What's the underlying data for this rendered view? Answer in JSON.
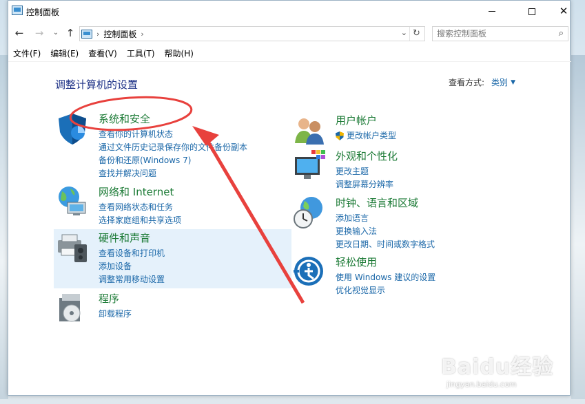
{
  "window": {
    "title": "控制面板",
    "close_glyph": "✕"
  },
  "nav": {
    "back_glyph": "←",
    "forward_glyph": "→",
    "recent_glyph": "⌄",
    "up_glyph": "↑",
    "address_sep": "›",
    "address_path": "控制面板",
    "address_sep_end": "›",
    "dropdown_glyph": "⌄",
    "refresh_glyph": "↻",
    "search_placeholder": "搜索控制面板",
    "search_glyph": "⌕"
  },
  "menu": {
    "items": [
      "文件(F)",
      "编辑(E)",
      "查看(V)",
      "工具(T)",
      "帮助(H)"
    ]
  },
  "main": {
    "heading": "调整计算机的设置",
    "view_by_label": "查看方式:",
    "view_by_value": "类别",
    "view_by_caret": "▼"
  },
  "categories": [
    {
      "title": "系统和安全",
      "icon": "shield-icon",
      "links": [
        "查看你的计算机状态",
        "通过文件历史记录保存你的文件备份副本",
        "备份和还原(Windows 7)",
        "查找并解决问题"
      ]
    },
    {
      "title": "网络和 Internet",
      "icon": "network-globe-icon",
      "links": [
        "查看网络状态和任务",
        "选择家庭组和共享选项"
      ]
    },
    {
      "title": "硬件和声音",
      "icon": "printer-speaker-icon",
      "links": [
        "查看设备和打印机",
        "添加设备",
        "调整常用移动设置"
      ]
    },
    {
      "title": "程序",
      "icon": "programs-disc-icon",
      "links": [
        "卸载程序"
      ]
    },
    {
      "title": "用户帐户",
      "icon": "user-accounts-icon",
      "links": [
        "更改帐户类型"
      ]
    },
    {
      "title": "外观和个性化",
      "icon": "monitor-palette-icon",
      "links": [
        "更改主题",
        "调整屏幕分辨率"
      ]
    },
    {
      "title": "时钟、语言和区域",
      "icon": "clock-globe-icon",
      "links": [
        "添加语言",
        "更换输入法",
        "更改日期、时间或数字格式"
      ]
    },
    {
      "title": "轻松使用",
      "icon": "ease-of-access-icon",
      "links": [
        "使用 Windows 建议的设置",
        "优化视觉显示"
      ]
    }
  ],
  "colors": {
    "category_title": "#1b7a35",
    "link": "#1a67a8",
    "heading": "#1e3287",
    "annotation_red": "#e8413d",
    "hover_highlight": "#e5f1fb"
  },
  "watermark": {
    "brand": "Baidu经验",
    "url": "jingyan.baidu.com"
  }
}
